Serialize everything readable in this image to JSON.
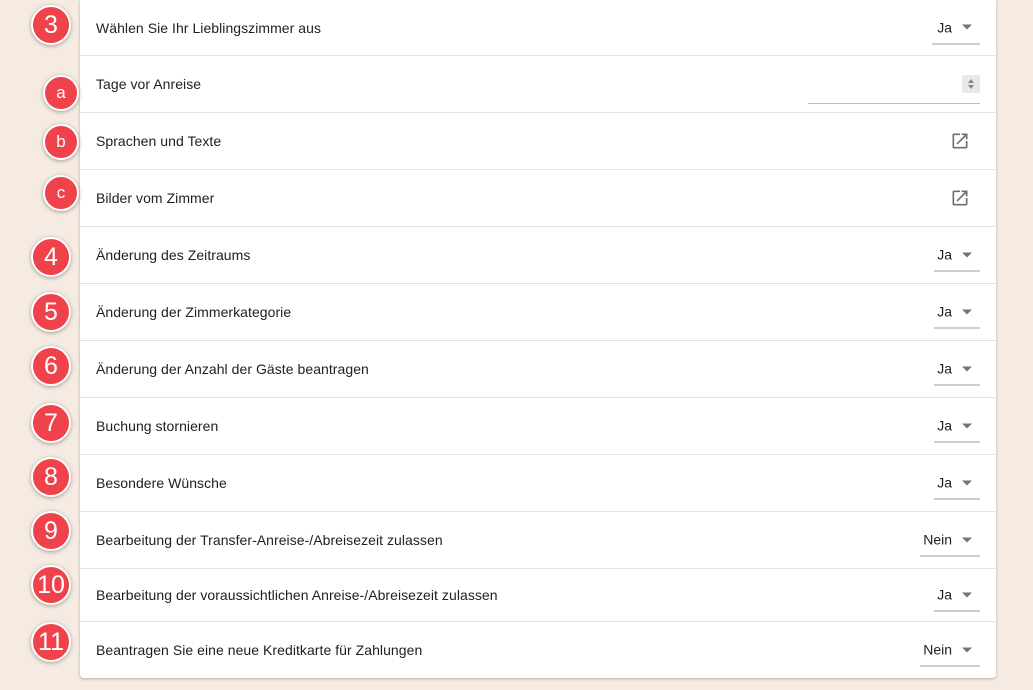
{
  "rows": [
    {
      "badge": "3",
      "label": "Wählen Sie Ihr Lieblingszimmer aus",
      "control": "select",
      "value": "Ja"
    },
    {
      "badge": "a",
      "label": "Tage vor Anreise",
      "control": "number",
      "value": ""
    },
    {
      "badge": "b",
      "label": "Sprachen und Texte",
      "control": "link",
      "icon": "open-in-new-icon"
    },
    {
      "badge": "c",
      "label": "Bilder vom Zimmer",
      "control": "link",
      "icon": "open-in-new-icon"
    },
    {
      "badge": "4",
      "label": "Änderung des Zeitraums",
      "control": "select",
      "value": "Ja"
    },
    {
      "badge": "5",
      "label": "Änderung der Zimmerkategorie",
      "control": "select",
      "value": "Ja"
    },
    {
      "badge": "6",
      "label": "Änderung der Anzahl der Gäste beantragen",
      "control": "select",
      "value": "Ja"
    },
    {
      "badge": "7",
      "label": "Buchung stornieren",
      "control": "select",
      "value": "Ja"
    },
    {
      "badge": "8",
      "label": "Besondere Wünsche",
      "control": "select",
      "value": "Ja"
    },
    {
      "badge": "9",
      "label": "Bearbeitung der Transfer-Anreise-/Abreisezeit zulassen",
      "control": "select",
      "value": "Nein"
    },
    {
      "badge": "10",
      "label": "Bearbeitung der voraussichtlichen Anreise-/Abreisezeit zulassen",
      "control": "select",
      "value": "Ja"
    },
    {
      "badge": "11",
      "label": "Beantragen Sie eine neue Kreditkarte für Zahlungen",
      "control": "select",
      "value": "Nein"
    }
  ],
  "colors": {
    "badge": "#f0424a",
    "background": "#f5ebe2",
    "panel": "#ffffff"
  }
}
